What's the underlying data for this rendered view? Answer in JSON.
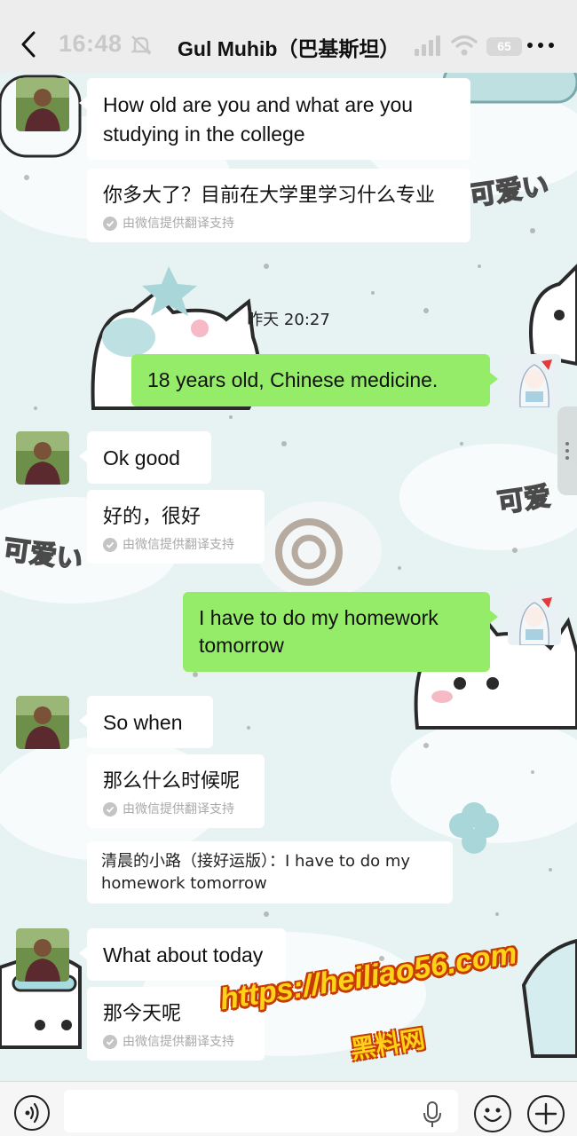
{
  "status_bar": {
    "time": "16:48",
    "battery": "65"
  },
  "header": {
    "title": "Gul Muhib（巴基斯坦）"
  },
  "messages": [
    {
      "side": "in",
      "text": "How old are you and what are you studying in the college",
      "translation": "你多大了？目前在大学里学习什么专业",
      "translation_note": "由微信提供翻译支持"
    },
    {
      "timestamp": "昨天 20:27"
    },
    {
      "side": "out",
      "text": "18 years old, Chinese medicine."
    },
    {
      "side": "in",
      "text": "Ok good",
      "translation": "好的，很好",
      "translation_note": "由微信提供翻译支持"
    },
    {
      "side": "out",
      "text": "I have to do my homework tomorrow"
    },
    {
      "side": "in",
      "text": "So when",
      "translation": "那么什么时候呢",
      "translation_note": "由微信提供翻译支持",
      "quote": "清晨的小路（接好运版）：I have to do my homework tomorrow"
    },
    {
      "side": "in",
      "text": "What about today",
      "translation": "那今天呢",
      "translation_note": "由微信提供翻译支持"
    }
  ],
  "wallpaper_stickers": [
    "可爱い",
    "可爱",
    "可爱い"
  ],
  "watermark": {
    "url": "https://heiliao56.com",
    "name": "黑料网"
  },
  "colors": {
    "out_bubble": "#95ec69",
    "in_bubble": "#ffffff",
    "wallpaper": "#e7f3f2",
    "header": "#ededed",
    "watermark_fill": "#ffd21a",
    "watermark_stroke": "#c63b00"
  },
  "icons": [
    "back-arrow-icon",
    "mute-bell-icon",
    "signal-icon",
    "wifi-icon",
    "more-icon",
    "voice-icon",
    "mic-icon",
    "emoji-icon",
    "plus-icon",
    "check-icon"
  ]
}
